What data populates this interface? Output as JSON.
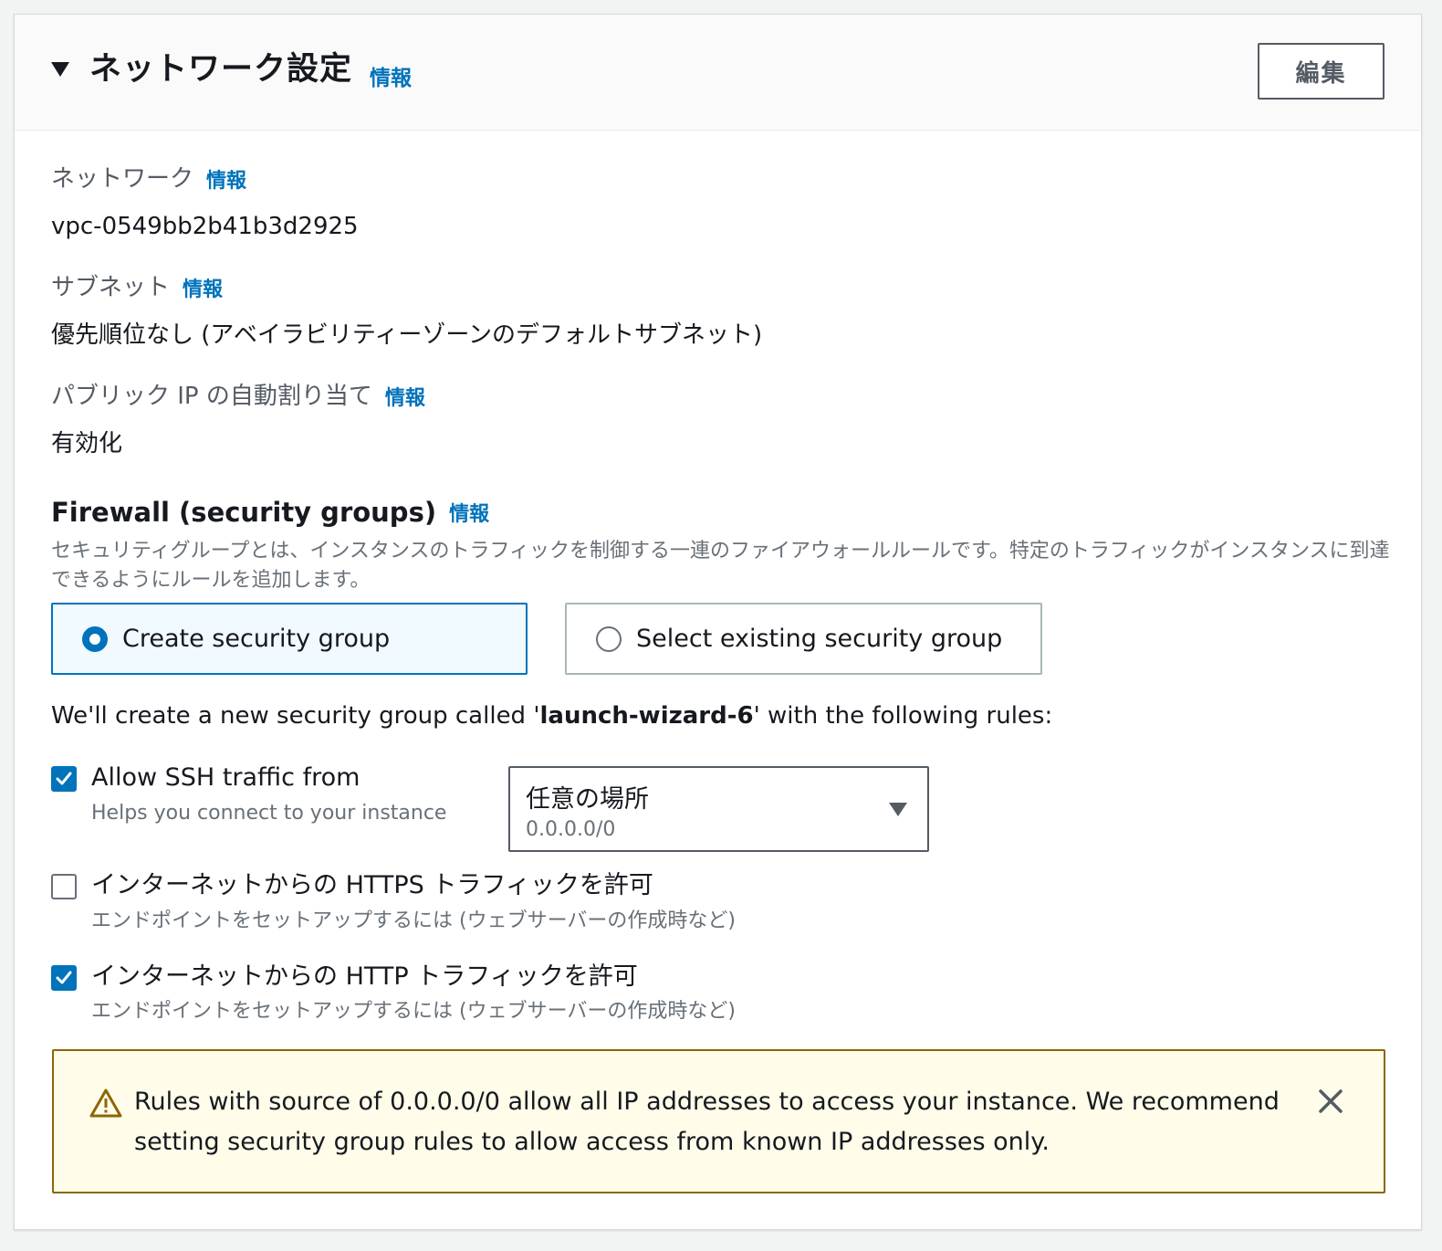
{
  "section": {
    "title": "ネットワーク設定",
    "info_label": "情報",
    "edit_label": "編集"
  },
  "network": {
    "label": "ネットワーク",
    "info_label": "情報",
    "value": "vpc-0549bb2b41b3d2925"
  },
  "subnet": {
    "label": "サブネット",
    "info_label": "情報",
    "value": "優先順位なし (アベイラビリティーゾーンのデフォルトサブネット)"
  },
  "public_ip": {
    "label": "パブリック IP の自動割り当て",
    "info_label": "情報",
    "value": "有効化"
  },
  "firewall": {
    "title": "Firewall (security groups)",
    "info_label": "情報",
    "description": "セキュリティグループとは、インスタンスのトラフィックを制御する一連のファイアウォールルールです。特定のトラフィックがインスタンスに到達できるようにルールを追加します。",
    "options": [
      {
        "label": "Create security group",
        "selected": true
      },
      {
        "label": "Select existing security group",
        "selected": false
      }
    ],
    "note_prefix": "We'll create a new security group called '",
    "note_name": "launch-wizard-6",
    "note_suffix": "' with the following rules:"
  },
  "rules": {
    "ssh": {
      "checked": true,
      "label": "Allow SSH traffic from",
      "sub": "Helps you connect to your instance",
      "source_value": "任意の場所",
      "source_cidr": "0.0.0.0/0"
    },
    "https": {
      "checked": false,
      "label": "インターネットからの HTTPS トラフィックを許可",
      "sub": "エンドポイントをセットアップするには (ウェブサーバーの作成時など)"
    },
    "http": {
      "checked": true,
      "label": "インターネットからの HTTP トラフィックを許可",
      "sub": "エンドポイントをセットアップするには (ウェブサーバーの作成時など)"
    }
  },
  "warning": {
    "text": "Rules with source of 0.0.0.0/0 allow all IP addresses to access your instance. We recommend setting security group rules to allow access from known IP addresses only."
  },
  "colors": {
    "link": "#0073bb",
    "selected_tile_bg": "#f1faff",
    "warning_border": "#8d6605",
    "warning_bg": "#fffce9"
  }
}
